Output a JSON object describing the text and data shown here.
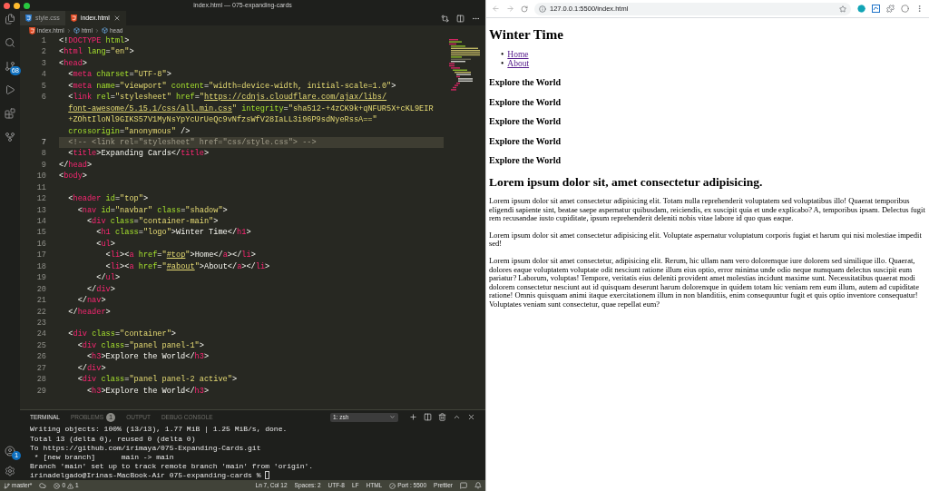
{
  "window": {
    "title": "index.html — 075-expanding-cards"
  },
  "activity_bar": {
    "source_control_badge": "68",
    "account_badge": "1"
  },
  "tabs": [
    {
      "label": "style.css",
      "kind": "css",
      "selected": false
    },
    {
      "label": "index.html",
      "kind": "html",
      "selected": true
    }
  ],
  "breadcrumb": [
    {
      "label": "index.html",
      "kind": "file"
    },
    {
      "label": "html",
      "kind": "element"
    },
    {
      "label": "head",
      "kind": "element"
    }
  ],
  "editor": {
    "rows": [
      {
        "number": "1",
        "current": false,
        "wrapped": false,
        "tokens": [
          {
            "kind": "p",
            "text": "<!"
          },
          {
            "kind": "tag",
            "text": "DOCTYPE"
          },
          {
            "kind": "attr",
            "text": " html"
          },
          {
            "kind": "p",
            "text": ">"
          }
        ]
      },
      {
        "number": "2",
        "current": false,
        "wrapped": false,
        "tokens": [
          {
            "kind": "p",
            "text": "<"
          },
          {
            "kind": "tag",
            "text": "html"
          },
          {
            "kind": "attr",
            "text": " lang"
          },
          {
            "kind": "p",
            "text": "="
          },
          {
            "kind": "str",
            "text": "\"en\""
          },
          {
            "kind": "p",
            "text": ">"
          }
        ]
      },
      {
        "number": "3",
        "current": false,
        "wrapped": false,
        "tokens": [
          {
            "kind": "p",
            "text": "<"
          },
          {
            "kind": "tag",
            "text": "head"
          },
          {
            "kind": "p",
            "text": ">"
          }
        ]
      },
      {
        "number": "4",
        "current": false,
        "wrapped": false,
        "tokens": [
          {
            "kind": "p",
            "text": "  <"
          },
          {
            "kind": "tag",
            "text": "meta"
          },
          {
            "kind": "attr",
            "text": " charset"
          },
          {
            "kind": "p",
            "text": "="
          },
          {
            "kind": "str",
            "text": "\"UTF-8\""
          },
          {
            "kind": "p",
            "text": ">"
          }
        ]
      },
      {
        "number": "5",
        "current": false,
        "wrapped": false,
        "tokens": [
          {
            "kind": "p",
            "text": "  <"
          },
          {
            "kind": "tag",
            "text": "meta"
          },
          {
            "kind": "attr",
            "text": " name"
          },
          {
            "kind": "p",
            "text": "="
          },
          {
            "kind": "str",
            "text": "\"viewport\""
          },
          {
            "kind": "attr",
            "text": " content"
          },
          {
            "kind": "p",
            "text": "="
          },
          {
            "kind": "str",
            "text": "\"width=device-width, initial-scale=1.0\""
          },
          {
            "kind": "p",
            "text": ">"
          }
        ]
      },
      {
        "number": "6",
        "current": false,
        "wrapped": false,
        "tokens": [
          {
            "kind": "p",
            "text": "  <"
          },
          {
            "kind": "tag",
            "text": "link"
          },
          {
            "kind": "attr",
            "text": " rel"
          },
          {
            "kind": "p",
            "text": "="
          },
          {
            "kind": "str",
            "text": "\"stylesheet\""
          },
          {
            "kind": "attr",
            "text": " href"
          },
          {
            "kind": "p",
            "text": "="
          },
          {
            "kind": "str",
            "text": "\""
          },
          {
            "kind": "link",
            "text": "https://cdnjs.cloudflare.com/ajax/libs/"
          }
        ]
      },
      {
        "current": false,
        "wrapped": true,
        "tokens": [
          {
            "kind": "link",
            "text": "font-awesome/5.15.1/css/all.min.css"
          },
          {
            "kind": "str",
            "text": "\""
          },
          {
            "kind": "attr",
            "text": " integrity"
          },
          {
            "kind": "p",
            "text": "="
          },
          {
            "kind": "str",
            "text": "\"sha512-+4zCK9k+qNFUR5X+cKL9EIR"
          }
        ]
      },
      {
        "current": false,
        "wrapped": true,
        "tokens": [
          {
            "kind": "str",
            "text": "+ZOhtIloNl9GIKS57V1MyNsYpYcUrUeQc9vNfzsWfV28IaLL3i96P9sdNyeRssA==\""
          }
        ]
      },
      {
        "current": false,
        "wrapped": true,
        "tokens": [
          {
            "kind": "attr",
            "text": "crossorigin"
          },
          {
            "kind": "p",
            "text": "="
          },
          {
            "kind": "str",
            "text": "\"anonymous\""
          },
          {
            "kind": "p",
            "text": " />"
          }
        ]
      },
      {
        "number": "7",
        "current": true,
        "wrapped": false,
        "tokens": [
          {
            "kind": "comment",
            "text": "  <!-- <link rel=\"stylesheet\" href=\"css/style.css\"> -->"
          }
        ]
      },
      {
        "number": "8",
        "current": false,
        "wrapped": false,
        "tokens": [
          {
            "kind": "p",
            "text": "  <"
          },
          {
            "kind": "tag",
            "text": "title"
          },
          {
            "kind": "p",
            "text": ">"
          },
          {
            "kind": "text",
            "text": "Expanding Cards"
          },
          {
            "kind": "p",
            "text": "</"
          },
          {
            "kind": "tag",
            "text": "title"
          },
          {
            "kind": "p",
            "text": ">"
          }
        ]
      },
      {
        "number": "9",
        "current": false,
        "wrapped": false,
        "tokens": [
          {
            "kind": "p",
            "text": "</"
          },
          {
            "kind": "tag",
            "text": "head"
          },
          {
            "kind": "p",
            "text": ">"
          }
        ]
      },
      {
        "number": "10",
        "current": false,
        "wrapped": false,
        "tokens": [
          {
            "kind": "p",
            "text": "<"
          },
          {
            "kind": "tag",
            "text": "body"
          },
          {
            "kind": "p",
            "text": ">"
          }
        ]
      },
      {
        "number": "11",
        "current": false
      },
      {
        "number": "12",
        "current": false,
        "wrapped": false,
        "tokens": [
          {
            "kind": "p",
            "text": "  <"
          },
          {
            "kind": "tag",
            "text": "header"
          },
          {
            "kind": "attr",
            "text": " id"
          },
          {
            "kind": "p",
            "text": "="
          },
          {
            "kind": "str",
            "text": "\"top\""
          },
          {
            "kind": "p",
            "text": ">"
          }
        ]
      },
      {
        "number": "13",
        "current": false,
        "wrapped": false,
        "tokens": [
          {
            "kind": "p",
            "text": "    <"
          },
          {
            "kind": "tag",
            "text": "nav"
          },
          {
            "kind": "attr",
            "text": " id"
          },
          {
            "kind": "p",
            "text": "="
          },
          {
            "kind": "str",
            "text": "\"navbar\""
          },
          {
            "kind": "attr",
            "text": " class"
          },
          {
            "kind": "p",
            "text": "="
          },
          {
            "kind": "str",
            "text": "\"shadow\""
          },
          {
            "kind": "p",
            "text": ">"
          }
        ]
      },
      {
        "number": "14",
        "current": false,
        "wrapped": false,
        "tokens": [
          {
            "kind": "p",
            "text": "      <"
          },
          {
            "kind": "tag",
            "text": "div"
          },
          {
            "kind": "attr",
            "text": " class"
          },
          {
            "kind": "p",
            "text": "="
          },
          {
            "kind": "str",
            "text": "\"container-main\""
          },
          {
            "kind": "p",
            "text": ">"
          }
        ]
      },
      {
        "number": "15",
        "current": false,
        "wrapped": false,
        "tokens": [
          {
            "kind": "p",
            "text": "        <"
          },
          {
            "kind": "tag",
            "text": "h1"
          },
          {
            "kind": "attr",
            "text": " class"
          },
          {
            "kind": "p",
            "text": "="
          },
          {
            "kind": "str",
            "text": "\"logo\""
          },
          {
            "kind": "p",
            "text": ">"
          },
          {
            "kind": "text",
            "text": "Winter Time"
          },
          {
            "kind": "p",
            "text": "</"
          },
          {
            "kind": "tag",
            "text": "h1"
          },
          {
            "kind": "p",
            "text": ">"
          }
        ]
      },
      {
        "number": "16",
        "current": false,
        "wrapped": false,
        "tokens": [
          {
            "kind": "p",
            "text": "        <"
          },
          {
            "kind": "tag",
            "text": "ul"
          },
          {
            "kind": "p",
            "text": ">"
          }
        ]
      },
      {
        "number": "17",
        "current": false,
        "wrapped": false,
        "tokens": [
          {
            "kind": "p",
            "text": "          <"
          },
          {
            "kind": "tag",
            "text": "li"
          },
          {
            "kind": "p",
            "text": "><"
          },
          {
            "kind": "tag",
            "text": "a"
          },
          {
            "kind": "attr",
            "text": " href"
          },
          {
            "kind": "p",
            "text": "="
          },
          {
            "kind": "str",
            "text": "\""
          },
          {
            "kind": "link",
            "text": "#top"
          },
          {
            "kind": "str",
            "text": "\""
          },
          {
            "kind": "p",
            "text": ">"
          },
          {
            "kind": "text",
            "text": "Home"
          },
          {
            "kind": "p",
            "text": "</"
          },
          {
            "kind": "tag",
            "text": "a"
          },
          {
            "kind": "p",
            "text": "></"
          },
          {
            "kind": "tag",
            "text": "li"
          },
          {
            "kind": "p",
            "text": ">"
          }
        ]
      },
      {
        "number": "18",
        "current": false,
        "wrapped": false,
        "tokens": [
          {
            "kind": "p",
            "text": "          <"
          },
          {
            "kind": "tag",
            "text": "li"
          },
          {
            "kind": "p",
            "text": "><"
          },
          {
            "kind": "tag",
            "text": "a"
          },
          {
            "kind": "attr",
            "text": " href"
          },
          {
            "kind": "p",
            "text": "="
          },
          {
            "kind": "str",
            "text": "\""
          },
          {
            "kind": "link",
            "text": "#about"
          },
          {
            "kind": "str",
            "text": "\""
          },
          {
            "kind": "p",
            "text": ">"
          },
          {
            "kind": "text",
            "text": "About"
          },
          {
            "kind": "p",
            "text": "</"
          },
          {
            "kind": "tag",
            "text": "a"
          },
          {
            "kind": "p",
            "text": "></"
          },
          {
            "kind": "tag",
            "text": "li"
          },
          {
            "kind": "p",
            "text": ">"
          }
        ]
      },
      {
        "number": "19",
        "current": false,
        "wrapped": false,
        "tokens": [
          {
            "kind": "p",
            "text": "        </"
          },
          {
            "kind": "tag",
            "text": "ul"
          },
          {
            "kind": "p",
            "text": ">"
          }
        ]
      },
      {
        "number": "20",
        "current": false,
        "wrapped": false,
        "tokens": [
          {
            "kind": "p",
            "text": "      </"
          },
          {
            "kind": "tag",
            "text": "div"
          },
          {
            "kind": "p",
            "text": ">"
          }
        ]
      },
      {
        "number": "21",
        "current": false,
        "wrapped": false,
        "tokens": [
          {
            "kind": "p",
            "text": "    </"
          },
          {
            "kind": "tag",
            "text": "nav"
          },
          {
            "kind": "p",
            "text": ">"
          }
        ]
      },
      {
        "number": "22",
        "current": false,
        "wrapped": false,
        "tokens": [
          {
            "kind": "p",
            "text": "  </"
          },
          {
            "kind": "tag",
            "text": "header"
          },
          {
            "kind": "p",
            "text": ">"
          }
        ]
      },
      {
        "number": "23",
        "current": false
      },
      {
        "number": "24",
        "current": false,
        "wrapped": false,
        "tokens": [
          {
            "kind": "p",
            "text": "  <"
          },
          {
            "kind": "tag",
            "text": "div"
          },
          {
            "kind": "attr",
            "text": " class"
          },
          {
            "kind": "p",
            "text": "="
          },
          {
            "kind": "str",
            "text": "\"container\""
          },
          {
            "kind": "p",
            "text": ">"
          }
        ]
      },
      {
        "number": "25",
        "current": false,
        "wrapped": false,
        "tokens": [
          {
            "kind": "p",
            "text": "    <"
          },
          {
            "kind": "tag",
            "text": "div"
          },
          {
            "kind": "attr",
            "text": " class"
          },
          {
            "kind": "p",
            "text": "="
          },
          {
            "kind": "str",
            "text": "\"panel panel-1\""
          },
          {
            "kind": "p",
            "text": ">"
          }
        ]
      },
      {
        "number": "26",
        "current": false,
        "wrapped": false,
        "tokens": [
          {
            "kind": "p",
            "text": "      <"
          },
          {
            "kind": "tag",
            "text": "h3"
          },
          {
            "kind": "p",
            "text": ">"
          },
          {
            "kind": "text",
            "text": "Explore the World"
          },
          {
            "kind": "p",
            "text": "</"
          },
          {
            "kind": "tag",
            "text": "h3"
          },
          {
            "kind": "p",
            "text": ">"
          }
        ]
      },
      {
        "number": "27",
        "current": false,
        "wrapped": false,
        "tokens": [
          {
            "kind": "p",
            "text": "    </"
          },
          {
            "kind": "tag",
            "text": "div"
          },
          {
            "kind": "p",
            "text": ">"
          }
        ]
      },
      {
        "number": "28",
        "current": false,
        "wrapped": false,
        "tokens": [
          {
            "kind": "p",
            "text": "    <"
          },
          {
            "kind": "tag",
            "text": "div"
          },
          {
            "kind": "attr",
            "text": " class"
          },
          {
            "kind": "p",
            "text": "="
          },
          {
            "kind": "str",
            "text": "\"panel panel-2 active\""
          },
          {
            "kind": "p",
            "text": ">"
          }
        ]
      },
      {
        "number": "29",
        "current": false,
        "wrapped": false,
        "tokens": [
          {
            "kind": "p",
            "text": "      <"
          },
          {
            "kind": "tag",
            "text": "h3"
          },
          {
            "kind": "p",
            "text": ">"
          },
          {
            "kind": "text",
            "text": "Explore the World"
          },
          {
            "kind": "p",
            "text": "</"
          },
          {
            "kind": "tag",
            "text": "h3"
          },
          {
            "kind": "p",
            "text": ">"
          }
        ]
      }
    ]
  },
  "panel": {
    "tabs": [
      {
        "label": "TERMINAL",
        "selected": true
      },
      {
        "label": "PROBLEMS",
        "selected": false,
        "badge": "1"
      },
      {
        "label": "OUTPUT",
        "selected": false
      },
      {
        "label": "DEBUG CONSOLE",
        "selected": false
      }
    ],
    "shell": "1: zsh",
    "terminal_lines": [
      "Writing objects: 100% (13/13), 1.77 MiB | 1.25 MiB/s, done.",
      "Total 13 (delta 0), reused 0 (delta 0)",
      "To https://github.com/irimaya/075-Expanding-Cards.git",
      " * [new branch]      main -> main",
      "Branch 'main' set up to track remote branch 'main' from 'origin'."
    ],
    "prompt": "irinadelgado@Irinas-MacBook-Air 075-expanding-cards %"
  },
  "status_bar": {
    "branch": "master*",
    "errors": "0",
    "warnings": "1",
    "items": [
      "Ln 7, Col 12",
      "Spaces: 2",
      "UTF-8",
      "LF",
      "HTML"
    ],
    "port": "Port : 5500",
    "formatter": "Prettier"
  },
  "browser": {
    "url": "127.0.0.1:5500/index.html",
    "page": {
      "heading": "Winter Time",
      "nav_links": [
        {
          "marker": "•",
          "label": "Home"
        },
        {
          "marker": "•",
          "label": "About"
        }
      ],
      "panels": [
        "Explore the World",
        "Explore the World",
        "Explore the World",
        "Explore the World",
        "Explore the World"
      ],
      "title": "Lorem ipsum dolor sit, amet consectetur adipisicing.",
      "paragraphs": [
        "Lorem ipsum dolor sit amet consectetur adipisicing elit. Totam nulla reprehenderit voluptatem sed voluptatibus illo! Quaerat temporibus eligendi sapiente sint, beatae saepe aspernatur quibusdam, reiciendis, ex suscipit quia et unde explicabo? A, temporibus ipsam. Delectus fugit rem recusandae iusto cupiditate, ipsum reprehenderit deleniti nobis vitae labore id quo quas eaque.",
        "Lorem ipsum dolor sit amet consectetur adipisicing elit. Voluptate aspernatur voluptatum corporis fugiat et harum qui nisi molestiae impedit sed!",
        "Lorem ipsum dolor sit amet consectetur, adipisicing elit. Rerum, hic ullam nam vero doloremque iure dolorem sed similique illo. Quaerat, dolores eaque voluptatem voluptate odit nesciunt ratione illum eius optio, error minima unde odio neque numquam delectus suscipit eum pariatur? Laborum, voluptas! Tempore, veritatis eius deleniti provident amet molestias incidunt maxime sunt. Necessitatibus quaerat modi dolorem consectetur nesciunt aut id quisquam deserunt harum doloremque in quidem totam hic veniam rem eum illum, autem ad cupiditate ratione! Omnis quisquam animi itaque exercitationem illum in non blanditiis, enim consequuntur fugit et quis optio inventore consequatur! Voluptates veniam sunt consectetur, quae repellat eum?"
      ]
    }
  }
}
